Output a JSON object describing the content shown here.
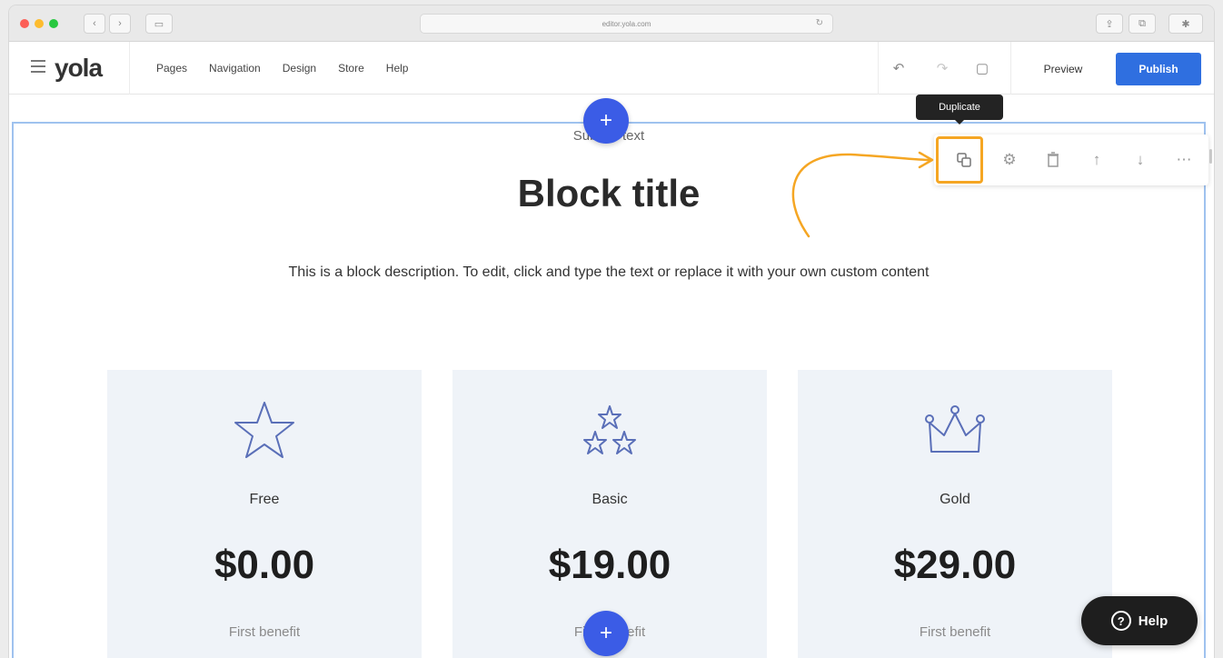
{
  "browser": {
    "url": "editor.yola.com",
    "back_icon": "chevron-left-icon",
    "forward_icon": "chevron-right-icon",
    "sidebar_icon": "sidebar-icon",
    "reload_icon": "reload-icon",
    "share_icon": "share-icon",
    "tabs_icon": "tabs-icon",
    "extension_icon": "extension-icon"
  },
  "editor": {
    "logo": "yola",
    "nav": [
      "Pages",
      "Navigation",
      "Design",
      "Store",
      "Help"
    ],
    "undo_icon": "undo-icon",
    "redo_icon": "redo-icon",
    "device_icon": "device-icon",
    "preview_label": "Preview",
    "publish_label": "Publish",
    "accent_color": "#2f6fe0"
  },
  "block": {
    "subtitle": "Subtitle text",
    "title": "Block title",
    "description": "This is a block description. To edit, click and type the text or replace it with your own custom content",
    "toolbar": {
      "tooltip": "Duplicate",
      "icons": [
        "duplicate-icon",
        "settings-icon",
        "delete-icon",
        "move-up-icon",
        "move-down-icon",
        "more-icon"
      ]
    }
  },
  "plans": [
    {
      "name": "Free",
      "price": "$0.00",
      "benefit": "First benefit",
      "icon": "star-icon"
    },
    {
      "name": "Basic",
      "price": "$19.00",
      "benefit": "First benefit",
      "icon": "stars-icon"
    },
    {
      "name": "Gold",
      "price": "$29.00",
      "benefit": "First benefit",
      "icon": "crown-icon"
    }
  ],
  "help_widget": {
    "label": "Help",
    "icon": "help-icon"
  },
  "add_block_icon": "plus-icon",
  "highlight_color": "#f5a623"
}
